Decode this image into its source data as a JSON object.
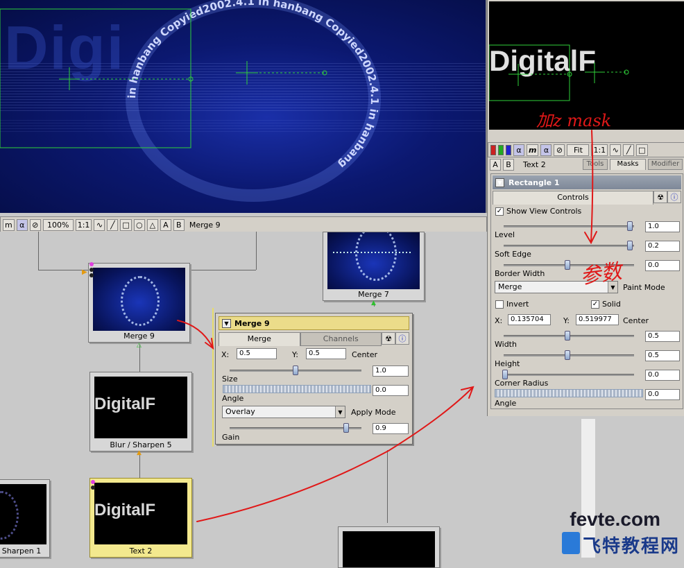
{
  "viewer": {
    "circle_text": "in hanbang Copyied2002.4.1 in hanbang Copyied2002.4.1 in hanbang",
    "ghost_text": "Digi",
    "toolbar": {
      "alpha": "α",
      "zoom": "100%",
      "ratio": "1:1",
      "tool_icons": [
        "bezier-icon",
        "pen-icon",
        "rect-icon",
        "circle-icon",
        "triangle-icon"
      ],
      "buffer_a": "A",
      "buffer_b": "B",
      "view_name": "Merge 9"
    }
  },
  "nodes": [
    {
      "label": "Merge 9"
    },
    {
      "label": "Merge 7"
    },
    {
      "label": "Blur / Sharpen 5"
    },
    {
      "label": "Text 2"
    },
    {
      "label": "Sharpen 1"
    }
  ],
  "thumb_text": "DigitalF",
  "merge_panel": {
    "title": "Merge 9",
    "tabs": [
      "Merge",
      "Channels"
    ],
    "x_label": "X:",
    "x_value": "0.5",
    "y_label": "Y:",
    "y_value": "0.5",
    "center_label": "Center",
    "size_label": "Size",
    "size_value": "1.0",
    "angle_label": "Angle",
    "angle_value": "0.0",
    "apply_mode_value": "Overlay",
    "apply_mode_label": "Apply Mode",
    "gain_label": "Gain",
    "gain_value": "0.9"
  },
  "right_panel": {
    "preview_text": "DigitalF",
    "annotation_mask": "加z mask",
    "annotation_params": "参数",
    "toolbar": {
      "alpha": "α",
      "m": "m",
      "fit": "Fit",
      "ratio": "1:1"
    },
    "buffer_a": "A",
    "buffer_b": "B",
    "view_name": "Text 2",
    "tabs": [
      "Tools",
      "Masks",
      "Modifier"
    ],
    "rect": {
      "title": "Rectangle 1",
      "controls_tab": "Controls",
      "show_view_controls": "Show View Controls",
      "level_label": "Level",
      "level_value": "1.0",
      "soft_edge_label": "Soft Edge",
      "soft_edge_value": "0.2",
      "border_width_label": "Border Width",
      "border_width_value": "0.0",
      "paint_mode_value": "Merge",
      "paint_mode_label": "Paint Mode",
      "invert_label": "Invert",
      "solid_label": "Solid",
      "x_label": "X:",
      "x_value": "0.135704",
      "y_label": "Y:",
      "y_value": "0.519977",
      "center_label": "Center",
      "width_label": "Width",
      "width_value": "0.5",
      "height_label": "Height",
      "height_value": "0.5",
      "corner_radius_label": "Corner Radius",
      "corner_radius_value": "0.0",
      "angle_label": "Angle",
      "angle_value": "0.0"
    }
  },
  "logo": {
    "text": "fevte.com",
    "chinese": "飞特教程网"
  },
  "colors": {
    "accent_annotation": "#e01818",
    "panel_title": "#ebdc8a",
    "viewer_bg": "#0b1870"
  }
}
